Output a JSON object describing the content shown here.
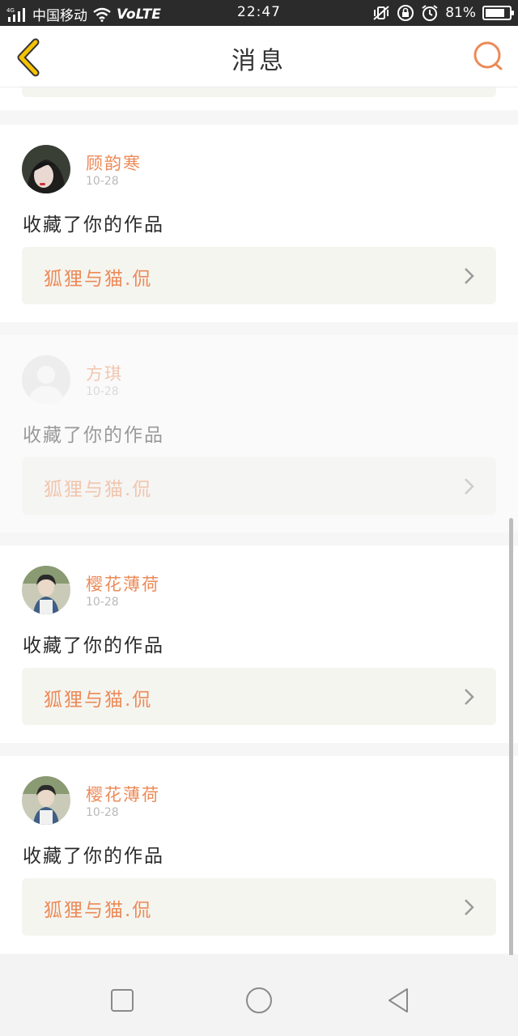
{
  "status_bar": {
    "network": "4G",
    "carrier": "中国移动",
    "volte": "VoLTE",
    "time": "22:47",
    "battery_text": "81%",
    "battery_level": 0.81
  },
  "header": {
    "title": "消息",
    "back_icon": "chevron-left-icon",
    "search_icon": "search-icon"
  },
  "messages": [
    {
      "name": "顾韵寒",
      "date": "10-28",
      "action": "收藏了你的作品",
      "work": "狐狸与猫.侃"
    },
    {
      "name": "方琪",
      "date": "10-28",
      "action": "收藏了你的作品",
      "work": "狐狸与猫.侃"
    },
    {
      "name": "樱花薄荷",
      "date": "10-28",
      "action": "收藏了你的作品",
      "work": "狐狸与猫.侃"
    },
    {
      "name": "樱花薄荷",
      "date": "10-28",
      "action": "收藏了你的作品",
      "work": "狐狸与猫.侃"
    }
  ],
  "colors": {
    "accent": "#ec8a58",
    "back_icon": "#f5c200",
    "link_bg": "#f5f5f0"
  },
  "nav": {
    "recent_icon": "square-icon",
    "home_icon": "circle-icon",
    "back_icon": "triangle-back-icon"
  }
}
